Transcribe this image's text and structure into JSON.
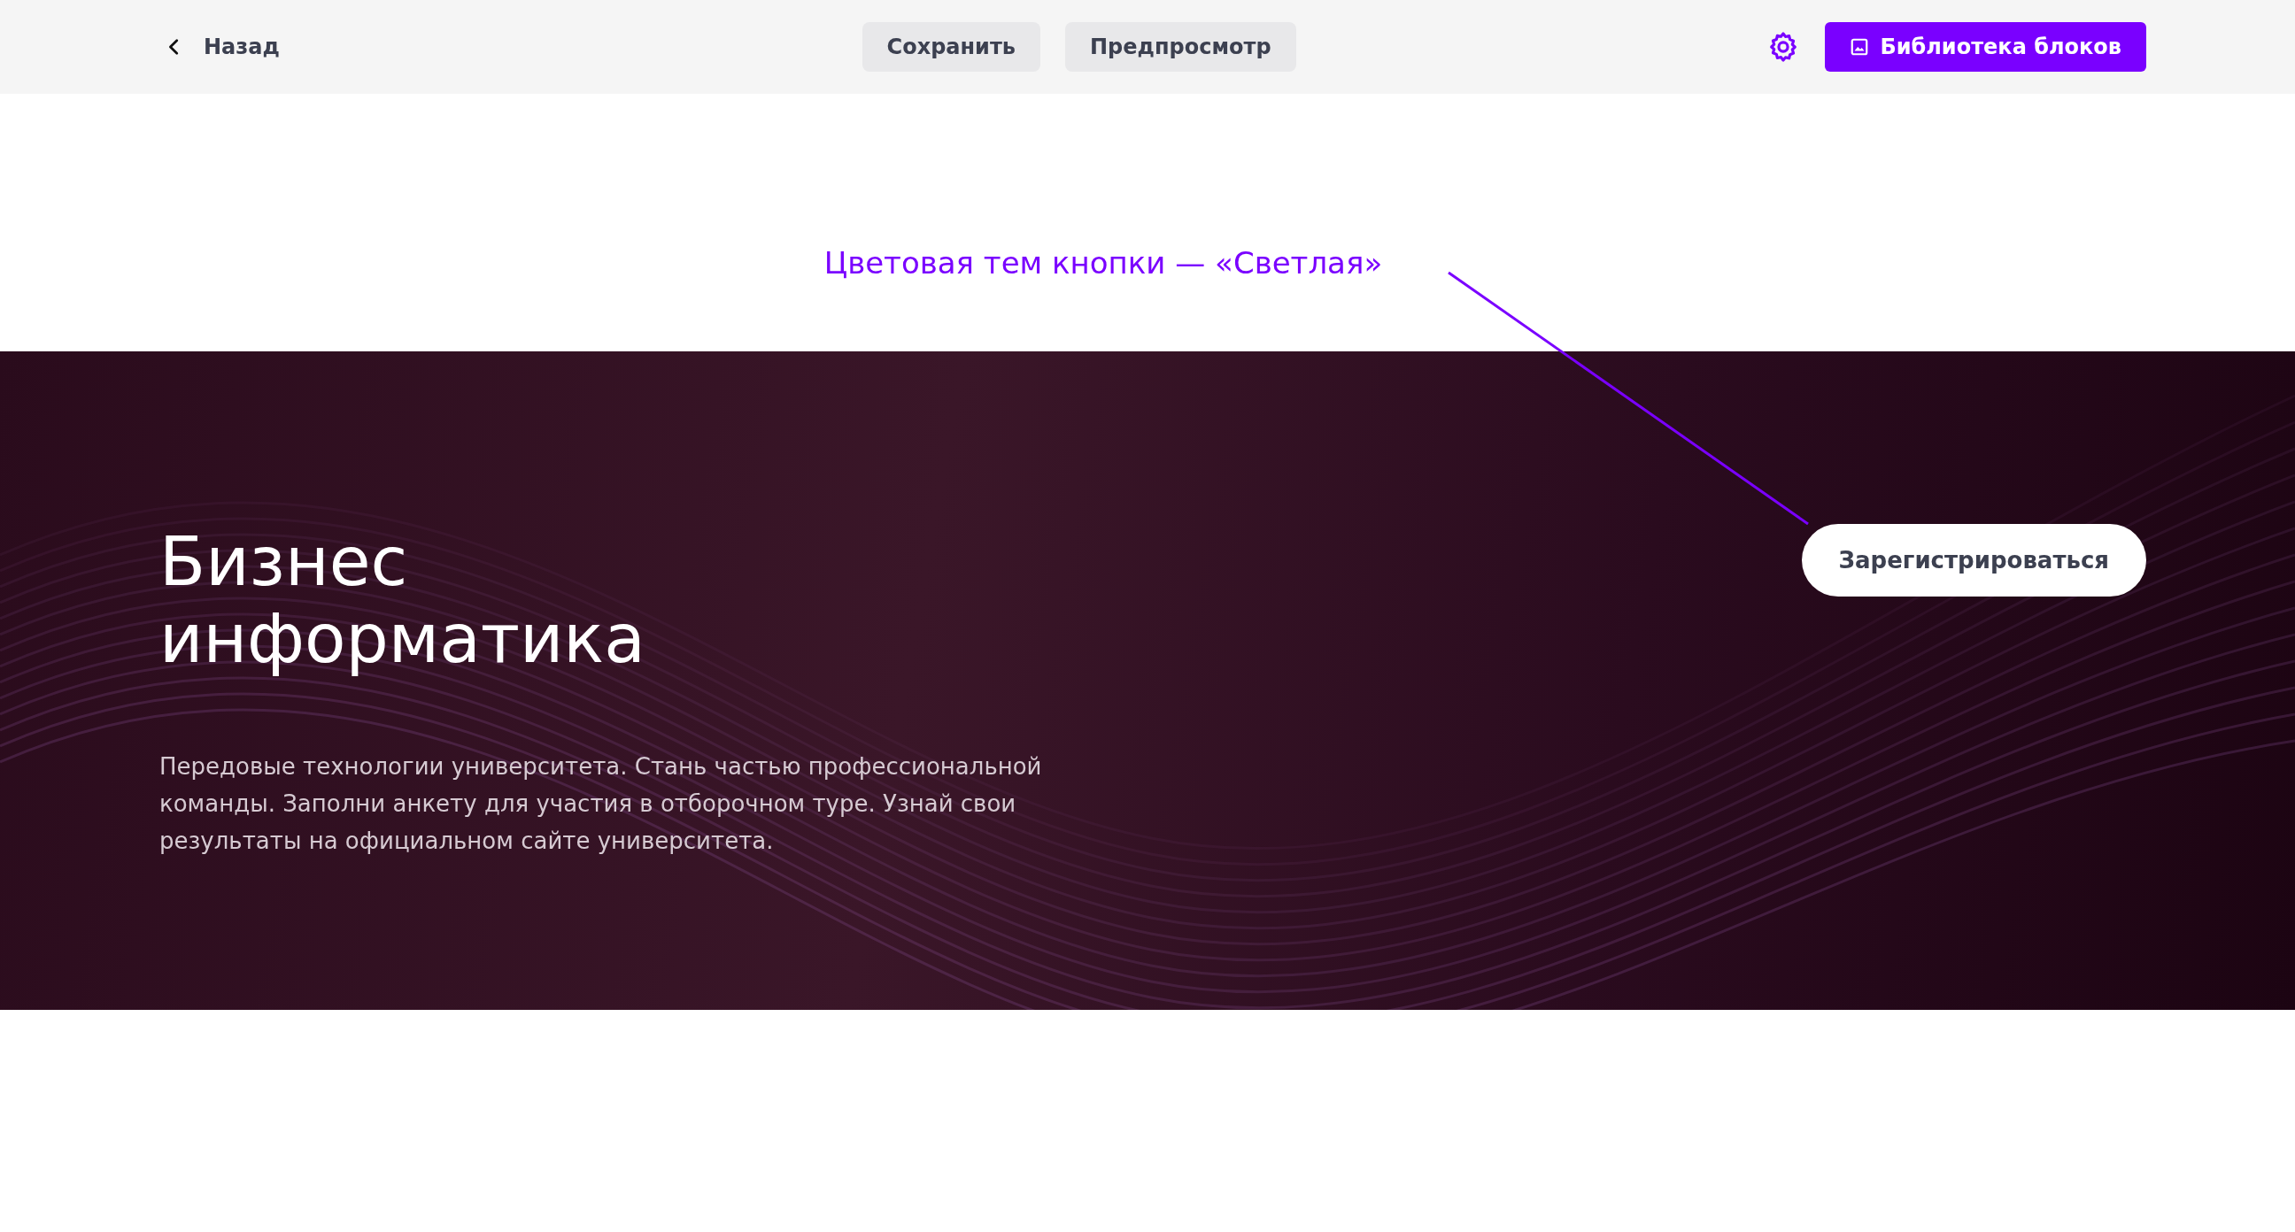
{
  "toolbar": {
    "back_label": "Назад",
    "buttons": [
      {
        "label": "Сохранить"
      },
      {
        "label": "Предпросмотр"
      }
    ],
    "library_button": "Библиотека блоков"
  },
  "annotation": "Цветовая тем кнопки — «Светлая»",
  "hero": {
    "title": "Бизнес информатика",
    "description": "Передовые технологии университета. Стань частью профессиональной команды. Заполни анкету для участия в отборочном туре. Узнай свои результаты на официальном сайте университета.",
    "button": {
      "label": "Зарегистрироваться"
    }
  }
}
